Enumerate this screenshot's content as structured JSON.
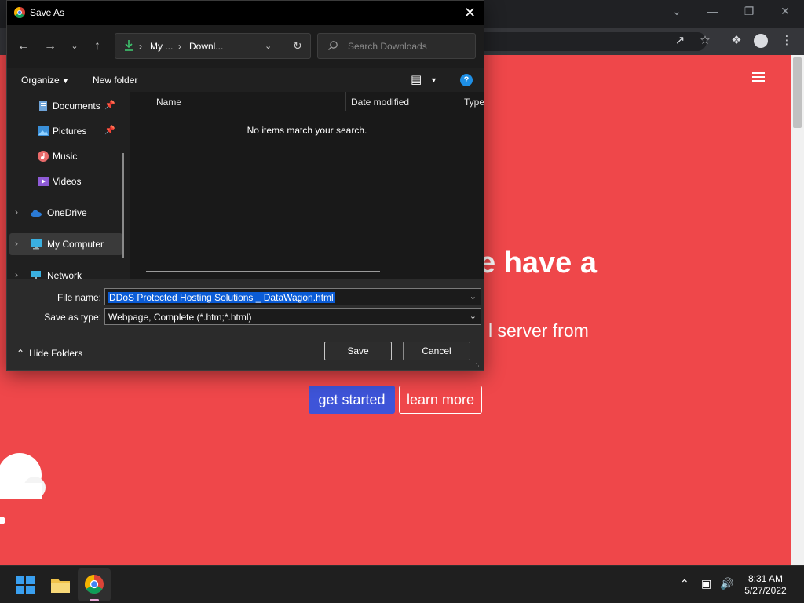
{
  "dialog": {
    "title": "Save As",
    "breadcrumb": [
      "My ...",
      "Downl..."
    ],
    "search_placeholder": "Search Downloads",
    "organize_label": "Organize",
    "new_folder_label": "New folder",
    "help_label": "?",
    "nav_items": [
      {
        "label": "Documents",
        "icon": "documents-icon",
        "pinned": true
      },
      {
        "label": "Pictures",
        "icon": "pictures-icon",
        "pinned": true
      },
      {
        "label": "Music",
        "icon": "music-icon",
        "pinned": false
      },
      {
        "label": "Videos",
        "icon": "videos-icon",
        "pinned": false
      },
      {
        "label": "OneDrive",
        "icon": "onedrive-icon",
        "expandable": true
      },
      {
        "label": "My Computer",
        "icon": "computer-icon",
        "expandable": true,
        "selected": true
      },
      {
        "label": "Network",
        "icon": "network-icon",
        "expandable": true
      }
    ],
    "columns": [
      "Name",
      "Date modified",
      "Type"
    ],
    "empty_message": "No items match your search.",
    "file_name_label": "File name:",
    "file_name_value": "DDoS Protected Hosting Solutions _ DataWagon.html",
    "save_type_label": "Save as type:",
    "save_type_value": "Webpage, Complete (*.htm;*.html)",
    "save_button": "Save",
    "cancel_button": "Cancel",
    "hide_folders": "Hide Folders"
  },
  "page": {
    "hero_title": "e have a",
    "hero_sub": "l server from",
    "get_started": "get started",
    "learn_more": "learn more",
    "accent_color": "#ef474a",
    "button_color": "#3e54d8"
  },
  "taskbar": {
    "time": "8:31 AM",
    "date": "5/27/2022"
  }
}
